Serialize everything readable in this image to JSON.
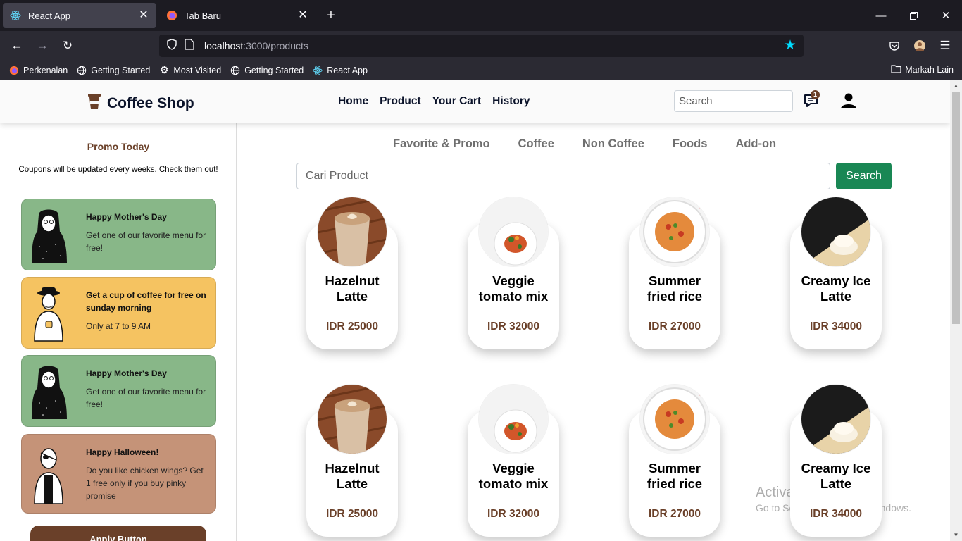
{
  "browser": {
    "tabs": [
      {
        "title": "React App",
        "active": true,
        "icon": "react-icon"
      },
      {
        "title": "Tab Baru",
        "active": false,
        "icon": "firefox-icon"
      }
    ],
    "url_host": "localhost",
    "url_path": ":3000/products",
    "bookmarks": [
      {
        "label": "Perkenalan",
        "icon": "firefox-icon"
      },
      {
        "label": "Getting Started",
        "icon": "globe-icon"
      },
      {
        "label": "Most Visited",
        "icon": "gear-icon"
      },
      {
        "label": "Getting Started",
        "icon": "globe-icon"
      },
      {
        "label": "React App",
        "icon": "react-icon"
      }
    ],
    "other_bookmarks": "Markah Lain",
    "colors": {
      "accent": "#00ddff",
      "chrome": "#2b2a33",
      "tabbar": "#1c1b22"
    }
  },
  "header": {
    "brand": "Coffee Shop",
    "nav": [
      "Home",
      "Product",
      "Your Cart",
      "History"
    ],
    "search_placeholder": "Search",
    "chat_badge": "1"
  },
  "sidebar": {
    "title": "Promo Today",
    "subtitle": "Coupons will be updated every weeks. Check them out!",
    "coupons": [
      {
        "title": "Happy Mother's Day",
        "desc": "Get one of our favorite menu for free!",
        "color": "#88b788"
      },
      {
        "title": "Get a cup of coffee for free on sunday morning",
        "desc": "Only at 7 to 9 AM",
        "color": "#f5c361"
      },
      {
        "title": "Happy Mother's Day",
        "desc": "Get one of our favorite menu for free!",
        "color": "#88b788"
      },
      {
        "title": "Happy Halloween!",
        "desc": "Do you like chicken wings? Get 1 free only if you buy pinky promise",
        "color": "#c59378"
      }
    ],
    "apply_button": "Apply Button"
  },
  "content": {
    "categories": [
      "Favorite & Promo",
      "Coffee",
      "Non Coffee",
      "Foods",
      "Add-on"
    ],
    "search_placeholder": "Cari Product",
    "search_button": "Search",
    "products": [
      {
        "name": "Hazelnut Latte",
        "price": "IDR 25000",
        "image": "latte"
      },
      {
        "name": "Veggie tomato mix",
        "price": "IDR 32000",
        "image": "veggie"
      },
      {
        "name": "Summer fried rice",
        "price": "IDR 27000",
        "image": "rice"
      },
      {
        "name": "Creamy Ice Latte",
        "price": "IDR 34000",
        "image": "icelatte"
      },
      {
        "name": "Hazelnut Latte",
        "price": "IDR 25000",
        "image": "latte"
      },
      {
        "name": "Veggie tomato mix",
        "price": "IDR 32000",
        "image": "veggie"
      },
      {
        "name": "Summer fried rice",
        "price": "IDR 27000",
        "image": "rice"
      },
      {
        "name": "Creamy Ice Latte",
        "price": "IDR 34000",
        "image": "icelatte"
      }
    ],
    "colors": {
      "brown": "#6a4029",
      "green_button": "#198754"
    }
  },
  "watermark": {
    "line1": "Activate Windows",
    "line2": "Go to Settings to activate Windows."
  }
}
